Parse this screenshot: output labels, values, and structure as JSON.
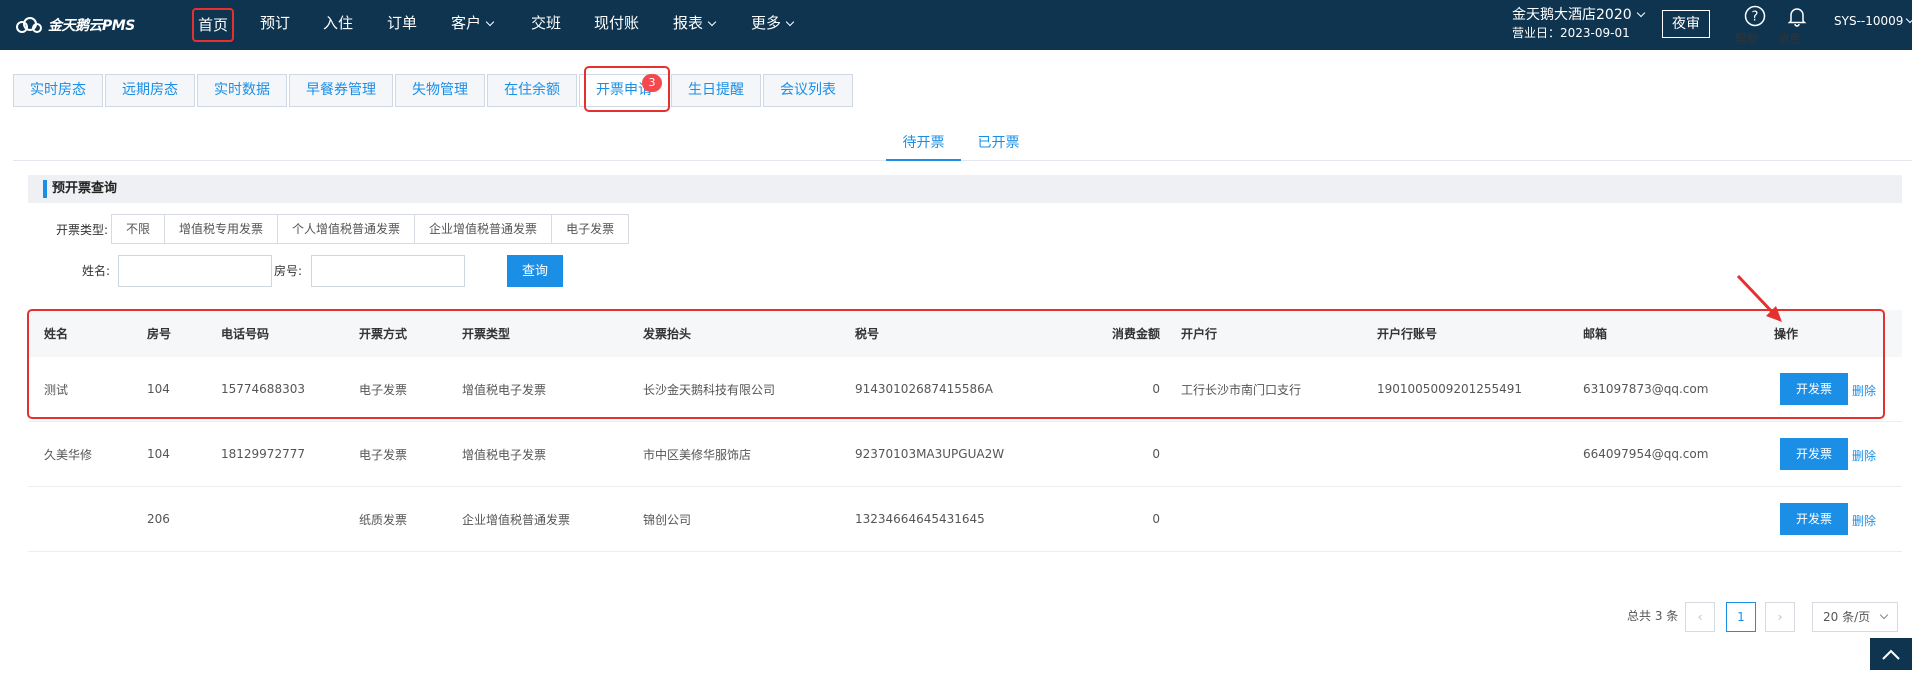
{
  "header": {
    "logo_text": "金天鹅云PMS",
    "nav": [
      {
        "label": "首页"
      },
      {
        "label": "预订"
      },
      {
        "label": "入住"
      },
      {
        "label": "订单"
      },
      {
        "label": "客户"
      },
      {
        "label": "交班"
      },
      {
        "label": "现付账"
      },
      {
        "label": "报表"
      },
      {
        "label": "更多"
      }
    ],
    "hotel_name": "金天鹅大酒店2020",
    "business_date": "营业日：2023-09-01",
    "night_audit": "夜审",
    "help": "帮助",
    "messages": "消息",
    "user": "SYS--10009"
  },
  "tabs": [
    {
      "label": "实时房态"
    },
    {
      "label": "远期房态"
    },
    {
      "label": "实时数据"
    },
    {
      "label": "早餐券管理"
    },
    {
      "label": "失物管理"
    },
    {
      "label": "在住余额"
    },
    {
      "label": "开票申请",
      "badge": "3"
    },
    {
      "label": "生日提醒"
    },
    {
      "label": "会议列表"
    }
  ],
  "subtabs": {
    "pending": "待开票",
    "done": "已开票"
  },
  "query": {
    "title": "预开票查询",
    "type_label": "开票类型:",
    "types": [
      "不限",
      "增值税专用发票",
      "个人增值税普通发票",
      "企业增值税普通发票",
      "电子发票"
    ],
    "name_label": "姓名:",
    "room_label": "房号:",
    "search_button": "查询"
  },
  "table": {
    "columns": [
      "姓名",
      "房号",
      "电话号码",
      "开票方式",
      "开票类型",
      "发票抬头",
      "税号",
      "消费金额",
      "开户行",
      "开户行账号",
      "邮箱",
      "操作"
    ],
    "rows": [
      {
        "name": "测试",
        "room": "104",
        "phone": "15774688303",
        "method": "电子发票",
        "type": "增值税电子发票",
        "title": "长沙金天鹅科技有限公司",
        "tax_no": "91430102687415586A",
        "amount": "0",
        "bank": "工行长沙市南门口支行",
        "account": "1901005009201255491",
        "email": "631097873@qq.com"
      },
      {
        "name": "久美华修",
        "room": "104",
        "phone": "18129972777",
        "method": "电子发票",
        "type": "增值税电子发票",
        "title": "市中区美修华服饰店",
        "tax_no": "92370103MA3UPGUA2W",
        "amount": "0",
        "bank": "",
        "account": "",
        "email": "664097954@qq.com"
      },
      {
        "name": "",
        "room": "206",
        "phone": "",
        "method": "纸质发票",
        "type": "企业增值税普通发票",
        "title": "锦创公司",
        "tax_no": "13234664645431645",
        "amount": "0",
        "bank": "",
        "account": "",
        "email": ""
      }
    ],
    "issue_button": "开发票",
    "delete_link": "删除"
  },
  "pagination": {
    "total": "总共 3 条",
    "current_page": "1",
    "page_size": "20 条/页"
  },
  "colors": {
    "header_bg": "#0f3450",
    "accent": "#1b8fe6",
    "highlight": "#e53030"
  }
}
